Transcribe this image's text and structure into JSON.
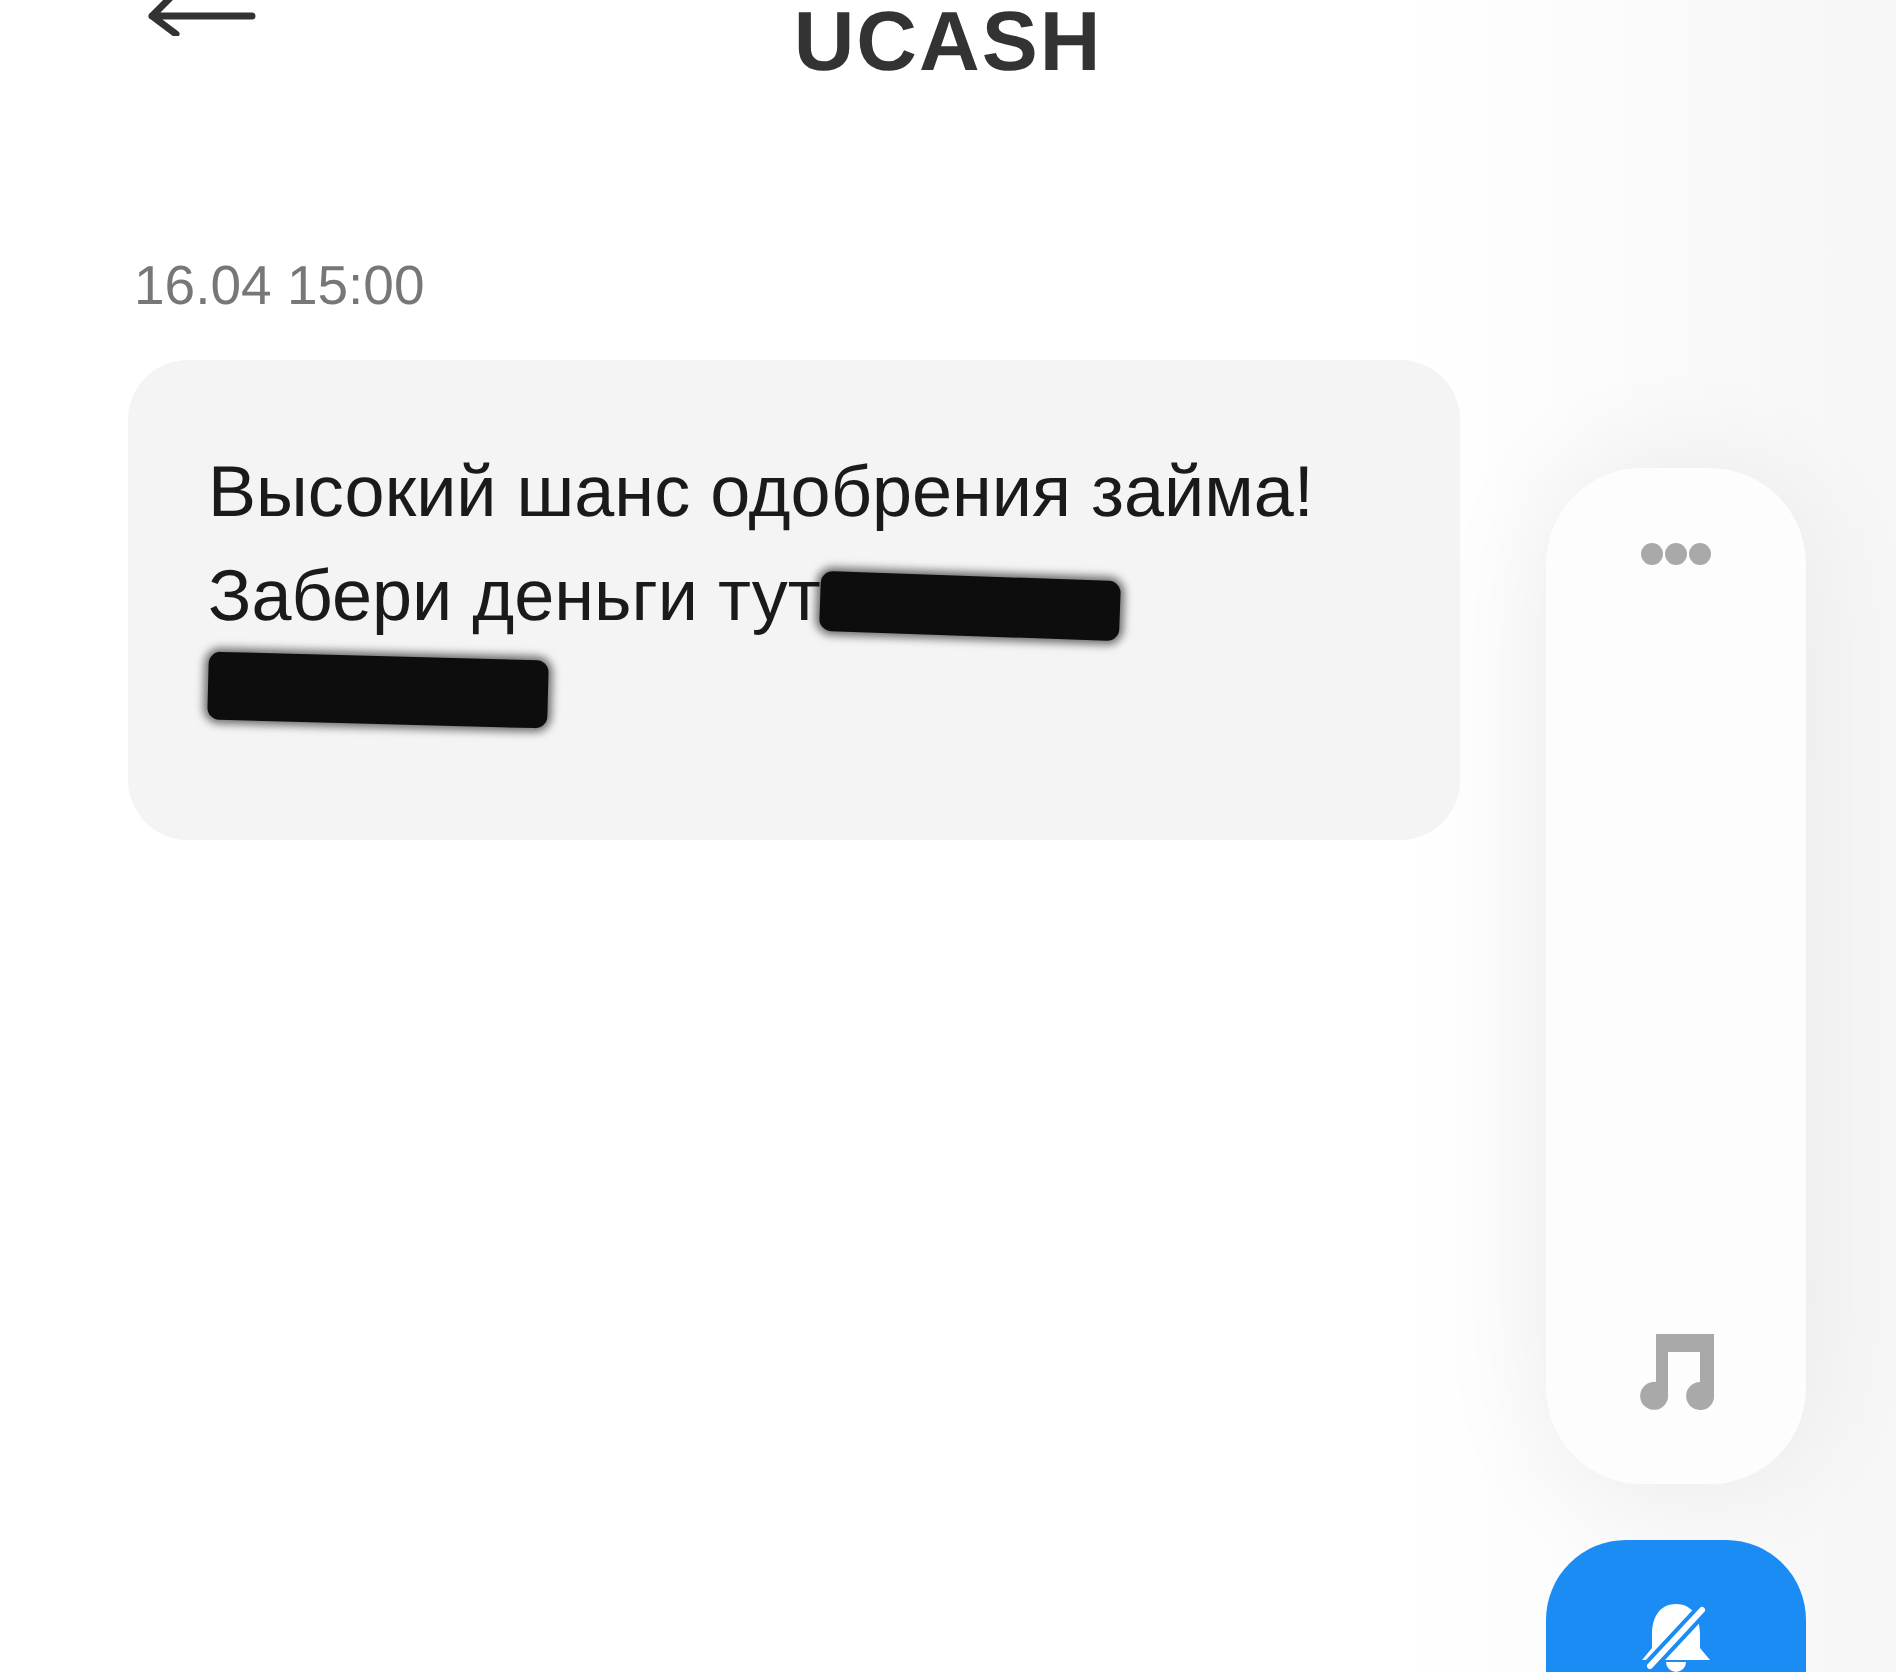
{
  "header": {
    "title": "UCASH"
  },
  "messages": [
    {
      "time": "16.04 15:00",
      "text": "Высокий шанс одобрения займа!\nЗабери деньги тут",
      "link_redacted": true
    }
  ],
  "volume_overlay": {
    "ringer_muted": true
  }
}
